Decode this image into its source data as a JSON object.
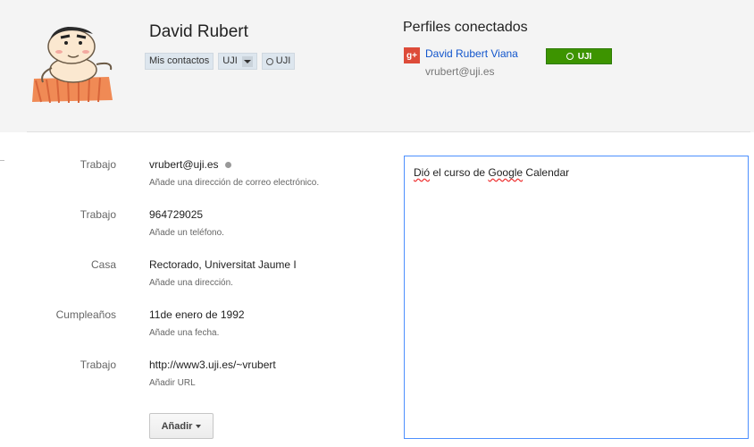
{
  "contact": {
    "name": "David Rubert",
    "chips": {
      "my_contacts": "Mis contactos",
      "uji_group": "UJI",
      "uji_circle": "UJI"
    }
  },
  "connected_profiles": {
    "title": "Perfiles conectados",
    "service_icon_text": "g+",
    "profile_name": "David Rubert Viana",
    "profile_email": "vrubert@uji.es",
    "badge_label": "UJI",
    "badge_color": "#3d9400"
  },
  "fields": [
    {
      "label": "Trabajo",
      "value": "vrubert@uji.es",
      "hint": "Añade una dirección de correo electrónico."
    },
    {
      "label": "Trabajo",
      "value": "964729025",
      "hint": "Añade un teléfono."
    },
    {
      "label": "Casa",
      "value": "Rectorado, Universitat Jaume I",
      "hint": "Añade una dirección."
    },
    {
      "label": "Cumpleaños",
      "value": "11de enero de 1992",
      "hint": "Añade una fecha."
    },
    {
      "label": "Trabajo",
      "value": "http://www3.uji.es/~vrubert",
      "hint": "Añadir URL"
    }
  ],
  "add_button": "Añadir",
  "notes": {
    "word1": "Dió",
    "text1": " el curso de ",
    "word2": "Google",
    "text2": " Calendar"
  },
  "colors": {
    "link": "#1155cc",
    "notes_border": "#4d90fe",
    "gplus": "#dd4b39"
  }
}
